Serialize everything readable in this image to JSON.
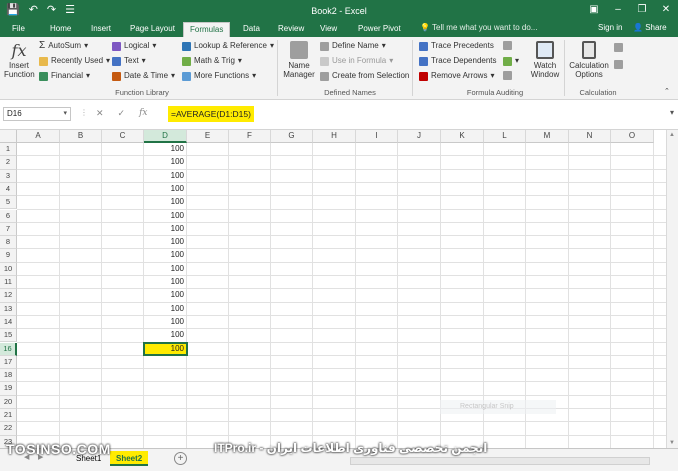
{
  "window": {
    "title": "Book2 - Excel",
    "qat_save": "💾",
    "qat_undo": "↶",
    "qat_redo": "↷",
    "qat_more": "☰",
    "min": "–",
    "restore": "❐",
    "close": "✕",
    "ribbon_opt": "▣"
  },
  "tabs": [
    "File",
    "Home",
    "Insert",
    "Page Layout",
    "Formulas",
    "Data",
    "Review",
    "View",
    "Power Pivot"
  ],
  "active_tab": "Formulas",
  "tellme": "Tell me what you want to do...",
  "signin": "Sign in",
  "share": "Share",
  "ribbon": {
    "insert_function": [
      "Insert",
      "Function"
    ],
    "library": {
      "autosum": "AutoSum",
      "recent": "Recently Used",
      "financial": "Financial",
      "logical": "Logical",
      "text": "Text",
      "datetime": "Date & Time",
      "lookup": "Lookup & Reference",
      "math": "Math & Trig",
      "more": "More Functions",
      "label": "Function Library"
    },
    "names": {
      "name_manager": [
        "Name",
        "Manager"
      ],
      "define": "Define Name",
      "use": "Use in Formula",
      "create": "Create from Selection",
      "label": "Defined Names"
    },
    "audit": {
      "precedents": "Trace Precedents",
      "dependents": "Trace Dependents",
      "remove": "Remove Arrows",
      "watch": [
        "Watch",
        "Window"
      ],
      "label": "Formula Auditing"
    },
    "calc": {
      "options": [
        "Calculation",
        "Options"
      ],
      "label": "Calculation"
    }
  },
  "formula_bar": {
    "name_box": "D16",
    "formula": "=AVERAGE(D1:D15)",
    "cancel": "✕",
    "enter": "✓",
    "fx": "fx"
  },
  "columns": [
    "A",
    "B",
    "C",
    "D",
    "E",
    "F",
    "G",
    "H",
    "I",
    "J",
    "K",
    "L",
    "M",
    "N",
    "O"
  ],
  "rows": [
    "1",
    "2",
    "3",
    "4",
    "5",
    "6",
    "7",
    "8",
    "9",
    "10",
    "11",
    "12",
    "13",
    "14",
    "15",
    "16",
    "17",
    "18",
    "19",
    "20",
    "21",
    "22",
    "23"
  ],
  "column_d": [
    "100",
    "100",
    "100",
    "100",
    "100",
    "100",
    "100",
    "100",
    "100",
    "100",
    "100",
    "100",
    "100",
    "100",
    "100",
    "100"
  ],
  "active_cell": "D16",
  "floating_tooltip": "Rectangular Snip",
  "sheets": [
    "Sheet1",
    "Sheet2"
  ],
  "active_sheet": "Sheet2",
  "add_sheet": "+",
  "nav_prev": "◀",
  "nav_next": "▶",
  "scroll_up": "▲",
  "scroll_down": "▼",
  "watermark_left": "TOSINSO.COM",
  "watermark_right": "ITPro.ir - انجمن تخصصی فناوری اطلاعات ایران"
}
